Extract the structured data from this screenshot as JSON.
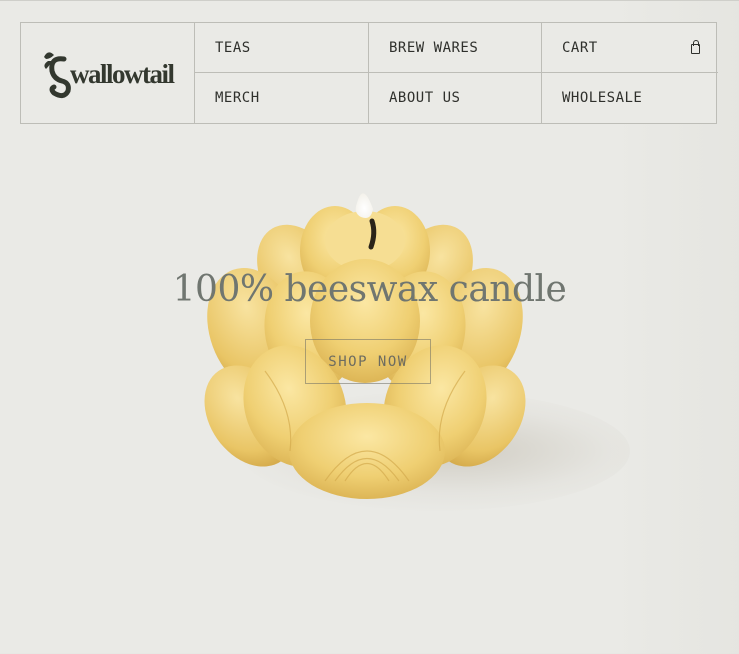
{
  "brand": {
    "name": "Swallowtail"
  },
  "nav": {
    "teas": "TEAS",
    "brew_wares": "BREW WARES",
    "cart": "CART",
    "merch": "MERCH",
    "about_us": "ABOUT US",
    "wholesale": "WHOLESALE"
  },
  "hero": {
    "title": "100% beeswax candle",
    "cta": "SHOP NOW"
  },
  "icons": {
    "cart": "shopping-bag-icon",
    "logo": "swallowtail-logo"
  },
  "colors": {
    "background": "#eaeae6",
    "text": "#2f302c",
    "candle": "#f0d27a",
    "border": "#bdbdb7"
  }
}
